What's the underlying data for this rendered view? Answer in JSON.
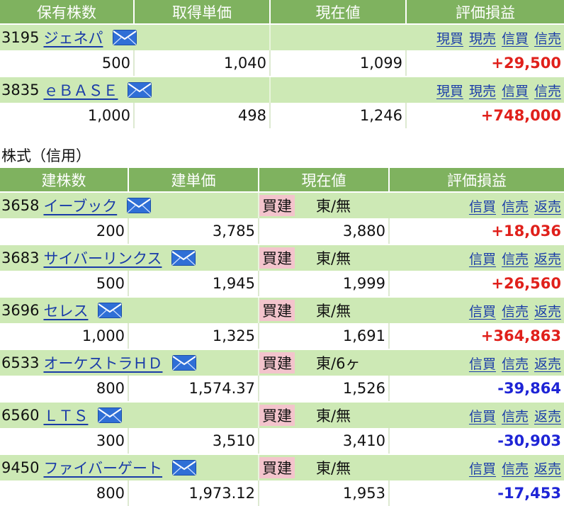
{
  "spot_table": {
    "headers": [
      "保有株数",
      "取得単価",
      "現在値",
      "評価損益"
    ],
    "rows": [
      {
        "code": "3195",
        "name": "ジェネパ",
        "actions": [
          "現買",
          "現売",
          "信買",
          "信売"
        ],
        "qty": "500",
        "cost": "1,040",
        "price": "1,099",
        "pl": "+29,500",
        "pl_sign": "pos"
      },
      {
        "code": "3835",
        "name": "ｅＢＡＳＥ",
        "actions": [
          "現買",
          "現売",
          "信買",
          "信売"
        ],
        "qty": "1,000",
        "cost": "498",
        "price": "1,246",
        "pl": "+748,000",
        "pl_sign": "pos"
      }
    ]
  },
  "margin_section_title": "株式（信用）",
  "margin_table": {
    "headers": [
      "建株数",
      "建単価",
      "現在値",
      "評価損益"
    ],
    "rows": [
      {
        "code": "3658",
        "name": "イーブック",
        "type": "買建",
        "market": "東/無",
        "actions": [
          "信買",
          "信売",
          "返売"
        ],
        "qty": "200",
        "cost": "3,785",
        "price": "3,880",
        "pl": "+18,036",
        "pl_sign": "pos"
      },
      {
        "code": "3683",
        "name": "サイバーリンクス",
        "type": "買建",
        "market": "東/無",
        "actions": [
          "信買",
          "信売",
          "返売"
        ],
        "qty": "500",
        "cost": "1,945",
        "price": "1,999",
        "pl": "+26,560",
        "pl_sign": "pos"
      },
      {
        "code": "3696",
        "name": "セレス",
        "type": "買建",
        "market": "東/無",
        "actions": [
          "信買",
          "信売",
          "返売"
        ],
        "qty": "1,000",
        "cost": "1,325",
        "price": "1,691",
        "pl": "+364,863",
        "pl_sign": "pos"
      },
      {
        "code": "6533",
        "name": "オーケストラＨＤ",
        "type": "買建",
        "market": "東/6ヶ",
        "actions": [
          "信買",
          "信売",
          "返売"
        ],
        "qty": "800",
        "cost": "1,574.37",
        "price": "1,526",
        "pl": "-39,864",
        "pl_sign": "neg"
      },
      {
        "code": "6560",
        "name": "ＬＴＳ",
        "type": "買建",
        "market": "東/無",
        "actions": [
          "信買",
          "信売",
          "返売"
        ],
        "qty": "300",
        "cost": "3,510",
        "price": "3,410",
        "pl": "-30,903",
        "pl_sign": "neg"
      },
      {
        "code": "9450",
        "name": "ファイバーゲート",
        "type": "買建",
        "market": "東/無",
        "actions": [
          "信買",
          "信売",
          "返売"
        ],
        "qty": "800",
        "cost": "1,973.12",
        "price": "1,953",
        "pl": "-17,453",
        "pl_sign": "neg"
      }
    ]
  },
  "colors": {
    "header": "#7fb25f",
    "row": "#cde9b5",
    "positive": "#e0201b",
    "negative": "#1e24d6",
    "badge": "#f3c4cc",
    "link": "#1a3ca8"
  },
  "icons": {
    "mail": "mail-icon"
  }
}
